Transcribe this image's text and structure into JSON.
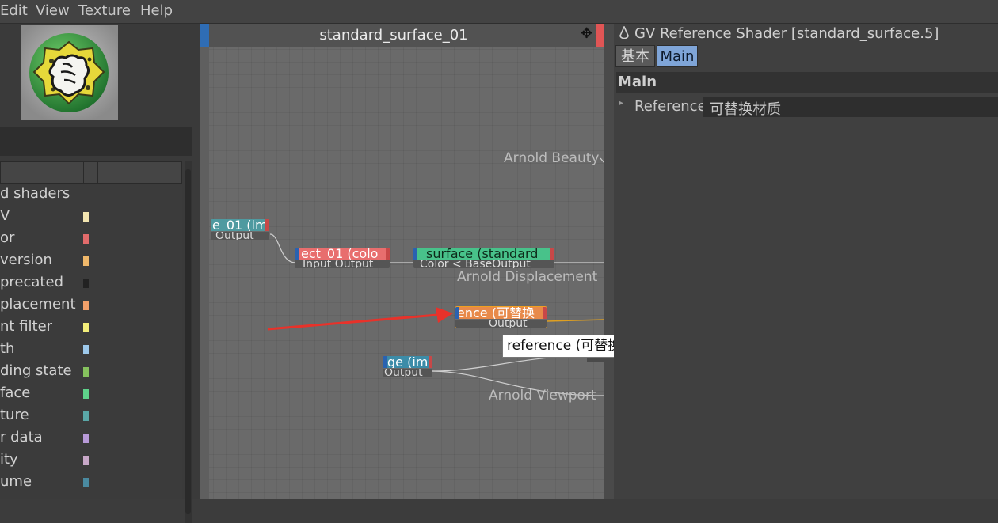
{
  "menu": [
    "Edit",
    "View",
    "Texture",
    "Help"
  ],
  "left_list": {
    "items": [
      {
        "label": "d shaders",
        "color": ""
      },
      {
        "label": "V",
        "color": "#f3e5b0"
      },
      {
        "label": "or",
        "color": "#e26b6b"
      },
      {
        "label": "version",
        "color": "#f0b86a"
      },
      {
        "label": "precated",
        "color": "#222222"
      },
      {
        "label": "placement",
        "color": "#f2a06a"
      },
      {
        "label": "nt filter",
        "color": "#f3ee7a"
      },
      {
        "label": "th",
        "color": "#9cc8ea"
      },
      {
        "label": "ding state",
        "color": "#86c25e"
      },
      {
        "label": "face",
        "color": "#5ed38a"
      },
      {
        "label": "ture",
        "color": "#5aa7a7"
      },
      {
        "label": "r data",
        "color": "#b89ad8"
      },
      {
        "label": "ity",
        "color": "#c8a8c8"
      },
      {
        "label": "ume",
        "color": "#4a8aa0"
      }
    ]
  },
  "editor": {
    "title": "standard_surface_01",
    "arrows_icon": "move-arrows-icon",
    "outputs": {
      "beauty": "Arnold Beauty",
      "displacement": "Arnold Displacement",
      "viewport": "Arnold Viewport"
    },
    "nodes": {
      "image_left": {
        "title": "e_01 (im",
        "port": "Output",
        "color": "#4f9aa0"
      },
      "rect": {
        "title": "ect_01 (colo",
        "port": "Input Output",
        "color": "#e86e6e"
      },
      "surface": {
        "title": "_surface (standard",
        "port": "Color < BaseOutput",
        "color": "#48c28a"
      },
      "reference": {
        "title": "ence (可替换",
        "port": "Output",
        "color": "#e88a4a"
      },
      "image_bottom": {
        "title": "ge (im",
        "port": "Output",
        "color": "#3c8ca8"
      }
    },
    "tooltip": "reference (可替换材质)"
  },
  "attributes": {
    "title": "GV Reference Shader [standard_surface.5]",
    "title_icon": "arnold-icon",
    "tabs": [
      {
        "label": "基本",
        "active": false
      },
      {
        "label": "Main",
        "active": true
      }
    ],
    "section": "Main",
    "reference_label": "Reference",
    "reference_value": "可替换材质"
  },
  "annotation": {
    "color": "#e8322a"
  }
}
